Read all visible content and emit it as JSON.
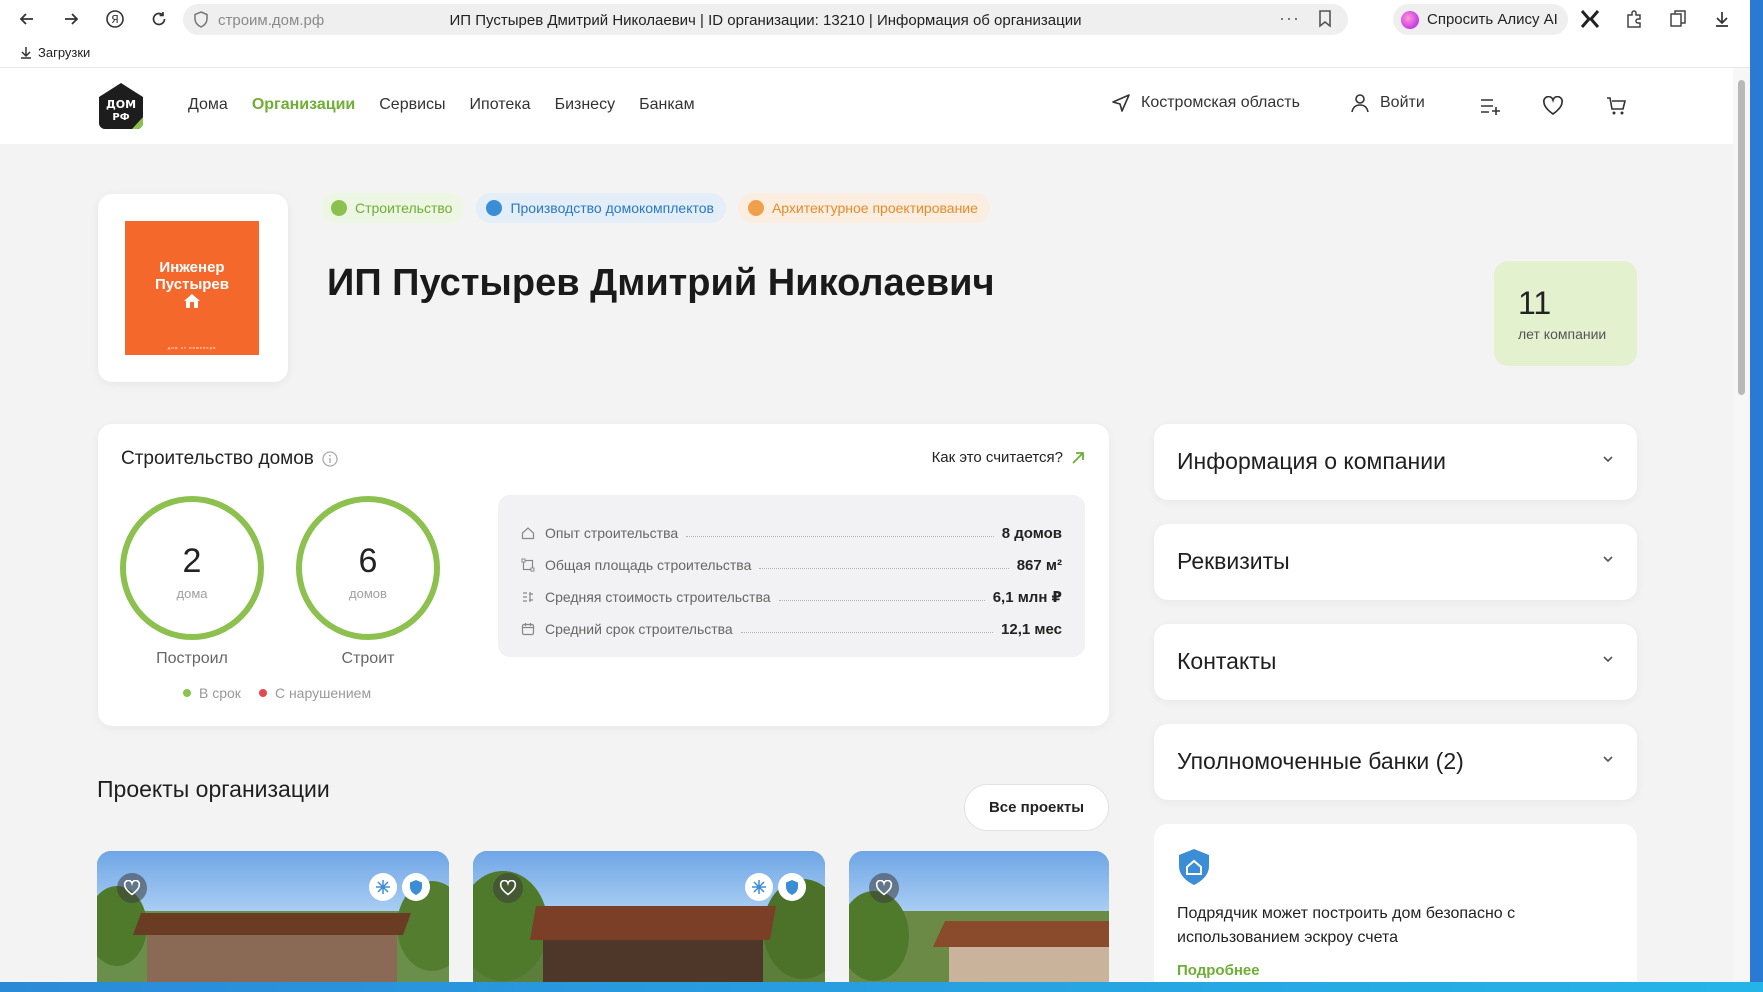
{
  "browser": {
    "domain": "строим.дом.рф",
    "page_title": "ИП Пустырев Дмитрий Николаевич | ID организации: 13210 | Информация об организации",
    "alice_label": "Спросить Алису AI",
    "downloads_label": "Загрузки"
  },
  "header": {
    "logo_text": "ДОМ РФ",
    "nav": [
      "Дома",
      "Организации",
      "Сервисы",
      "Ипотека",
      "Бизнесу",
      "Банкам"
    ],
    "active_nav": "Организации",
    "region": "Костромская область",
    "login": "Войти"
  },
  "org": {
    "logo_line1": "Инженер",
    "logo_line2": "Пустырев",
    "logo_tagline": "дом от инженера",
    "tags": [
      "Строительство",
      "Производство домокомплектов",
      "Архитектурное проектирование"
    ],
    "title": "ИП Пустырев Дмитрий Николаевич",
    "years_value": "11",
    "years_label": "лет компании"
  },
  "construction": {
    "title": "Строительство домов",
    "how_link": "Как это считается?",
    "built_value": "2",
    "built_unit": "дома",
    "built_caption": "Построил",
    "building_value": "6",
    "building_unit": "домов",
    "building_caption": "Строит",
    "legend_ontime": "В срок",
    "legend_violation": "С нарушением",
    "stats": [
      {
        "label": "Опыт строительства",
        "value": "8 домов"
      },
      {
        "label": "Общая площадь строительства",
        "value": "867 м²"
      },
      {
        "label": "Средняя стоимость строительства",
        "value": "6,1 млн ₽"
      },
      {
        "label": "Средний срок строительства",
        "value": "12,1 мес"
      }
    ]
  },
  "projects": {
    "title": "Проекты организации",
    "all_button": "Все проекты"
  },
  "sidebar": {
    "accordions": [
      "Информация о компании",
      "Реквизиты",
      "Контакты",
      "Уполномоченные банки (2)"
    ],
    "escrow_text": "Подрядчик может построить дом безопасно с использованием эскроу счета",
    "escrow_more": "Подробнее"
  },
  "colors": {
    "accent_green": "#6fae34",
    "ring_green": "#8cc04f",
    "tag_blue": "#2a78c2",
    "tag_orange": "#e48c2b",
    "logo_orange": "#f5682b",
    "violation_red": "#e5484d"
  }
}
